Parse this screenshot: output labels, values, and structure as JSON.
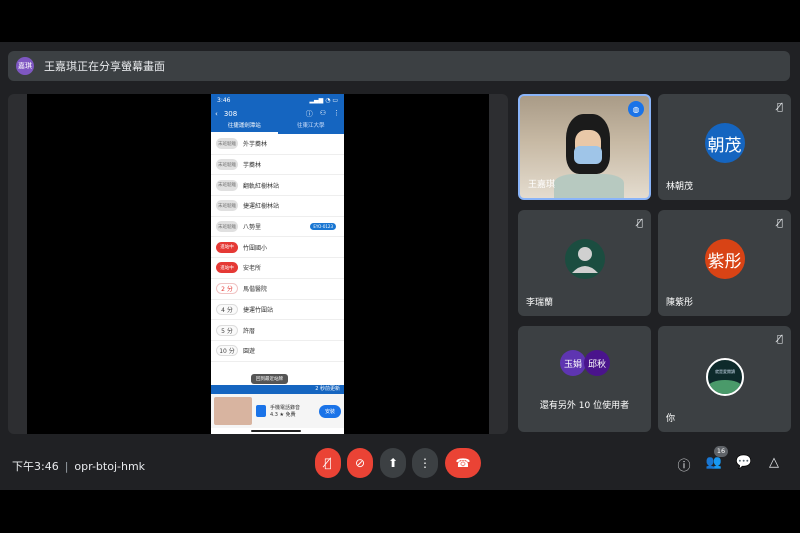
{
  "banner": {
    "avatar_text": "嘉琪",
    "text": "王嘉琪正在分享螢幕畫面"
  },
  "phone": {
    "status_time": "3:46",
    "route": "308",
    "tabs": [
      "往捷運劍潭站",
      "往東江大學"
    ],
    "stops": [
      {
        "badge": "末班駛離",
        "name": "外芋蕎林",
        "type": "gray"
      },
      {
        "badge": "末班駛離",
        "name": "芋蕎林",
        "type": "gray"
      },
      {
        "badge": "末班駛離",
        "name": "翻軌紅樹林站",
        "type": "gray"
      },
      {
        "badge": "末班駛離",
        "name": "捷運紅樹林站",
        "type": "gray"
      },
      {
        "badge": "末班駛離",
        "name": "八勢里",
        "type": "gray",
        "tag": "EYO-0123"
      },
      {
        "badge": "進站中",
        "name": "竹圍國小",
        "type": "red"
      },
      {
        "badge": "進站中",
        "name": "安老所",
        "type": "red"
      },
      {
        "badge": "2 分",
        "name": "馬偕醫院",
        "type": "min"
      },
      {
        "badge": "4 分",
        "name": "捷運竹圍站",
        "type": "gray2"
      },
      {
        "badge": "5 分",
        "name": "許厝",
        "type": "gray2"
      },
      {
        "badge": "10 分",
        "name": "園遊",
        "type": "gray2"
      }
    ],
    "toast": "回到最近站牌",
    "update": "2 秒前更新",
    "ad_title": "手機電話錄音",
    "ad_sub": "4.3 ★ 免費",
    "ad_button": "安裝"
  },
  "participants": [
    {
      "name": "王嘉琪",
      "type": "video"
    },
    {
      "name": "林朝茂",
      "avatar": "朝茂",
      "color": "#1565c0"
    },
    {
      "name": "李瑞蘭",
      "type": "default"
    },
    {
      "name": "陳紫彤",
      "avatar": "紫彤",
      "color": "#d84315"
    },
    {
      "more_text": "還有另外 10 位使用者",
      "avatars": [
        "玉娟",
        "邱秋"
      ],
      "colors": [
        "#5e35b1",
        "#4a148c"
      ]
    },
    {
      "name": "你",
      "type": "logo",
      "logo_text": "就是愛閱讀"
    }
  ],
  "bottom": {
    "time": "下午3:46",
    "meeting_code": "opr-btoj-hmk",
    "people_count": "16"
  }
}
